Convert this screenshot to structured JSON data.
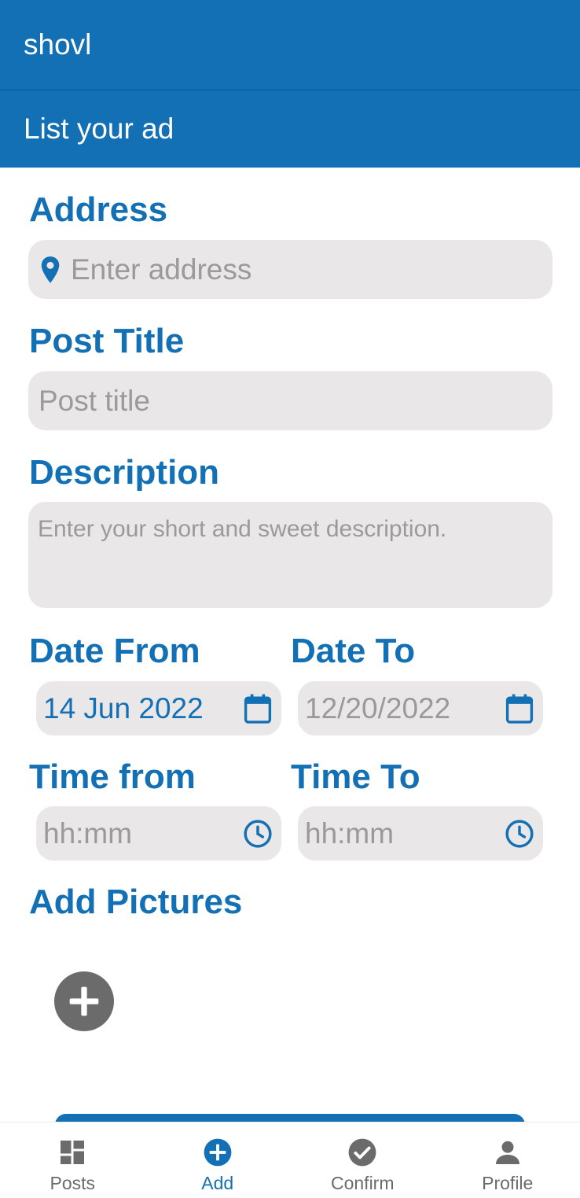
{
  "app": {
    "name": "shovl"
  },
  "page": {
    "title": "List your ad"
  },
  "colors": {
    "primary": "#1370b4",
    "field_bg": "#e9e7e8",
    "placeholder": "#9a9a9a",
    "inactive": "#6b6b6b"
  },
  "form": {
    "address": {
      "label": "Address",
      "placeholder": "Enter address",
      "icon": "location-pin-icon"
    },
    "post_title": {
      "label": "Post Title",
      "placeholder": "Post title"
    },
    "description": {
      "label": "Description",
      "placeholder": "Enter your short and sweet description."
    },
    "date_from": {
      "label": "Date From",
      "value": "14 Jun 2022",
      "icon": "calendar-icon"
    },
    "date_to": {
      "label": "Date To",
      "value": "12/20/2022",
      "icon": "calendar-icon"
    },
    "time_from": {
      "label": "Time from",
      "placeholder": "hh:mm",
      "icon": "clock-icon"
    },
    "time_to": {
      "label": "Time To",
      "placeholder": "hh:mm",
      "icon": "clock-icon"
    },
    "pictures": {
      "label": "Add Pictures",
      "icon": "add-circle-icon"
    }
  },
  "bottom_nav": {
    "items": [
      {
        "label": "Posts",
        "icon": "dashboard-icon",
        "active": false
      },
      {
        "label": "Add",
        "icon": "add-circle-icon",
        "active": true
      },
      {
        "label": "Confirm",
        "icon": "check-circle-icon",
        "active": false
      },
      {
        "label": "Profile",
        "icon": "person-icon",
        "active": false
      }
    ]
  }
}
